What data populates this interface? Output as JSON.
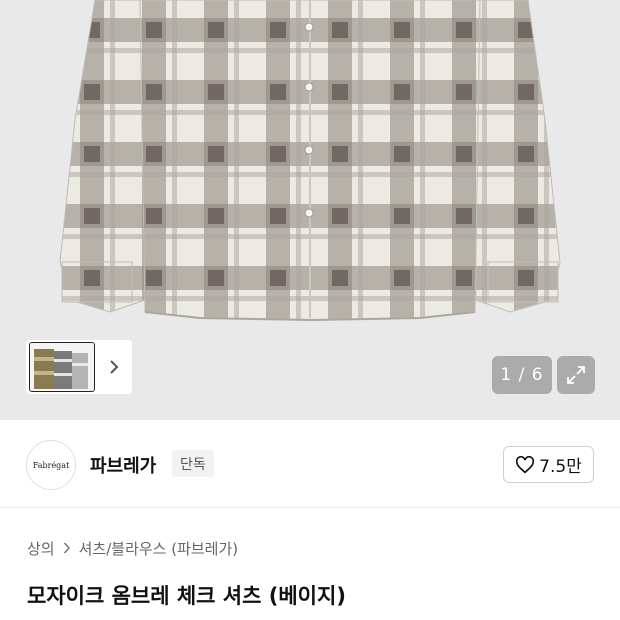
{
  "gallery": {
    "counter": "1 / 6",
    "expand_icon": "expand-icon",
    "next_icon": "chevron-right-icon",
    "colors": {
      "background": "#e9e9e9",
      "check_light": "#e8e8e0",
      "check_dark": "#6b6460"
    }
  },
  "brand": {
    "logo_text": "Fabrégat",
    "name": "파브레가",
    "tag": "단독"
  },
  "like": {
    "icon": "heart-icon",
    "count": "7.5만"
  },
  "breadcrumb": {
    "items": [
      "상의",
      "셔츠/블라우스 (파브레가)"
    ],
    "separator_icon": "chevron-right-icon"
  },
  "product": {
    "title": "모자이크 옴브레 체크 셔츠 (베이지)"
  }
}
